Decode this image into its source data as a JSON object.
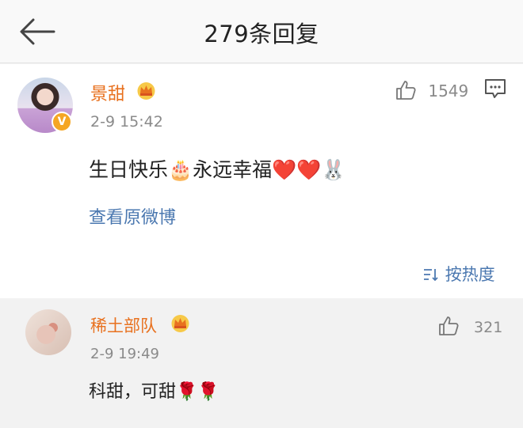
{
  "header": {
    "title": "279条回复"
  },
  "main_comment": {
    "author": "景甜",
    "verified_badge": "V",
    "time": "2-9 15:42",
    "content": "生日快乐🎂永远幸福❤️❤️🐰",
    "likes": "1549",
    "view_original": "查看原微博",
    "sort_label": "按热度"
  },
  "replies": [
    {
      "author": "稀土部队",
      "time": "2-9 19:49",
      "content": "科甜，可甜🌹🌹",
      "likes": "321"
    }
  ],
  "colors": {
    "name_orange": "#e8711f",
    "link_blue": "#4b78b0",
    "meta_gray": "#8a8a8a"
  },
  "icons": [
    "back-arrow-icon",
    "crown-icon",
    "thumb-up-icon",
    "comment-icon",
    "sort-icon"
  ]
}
